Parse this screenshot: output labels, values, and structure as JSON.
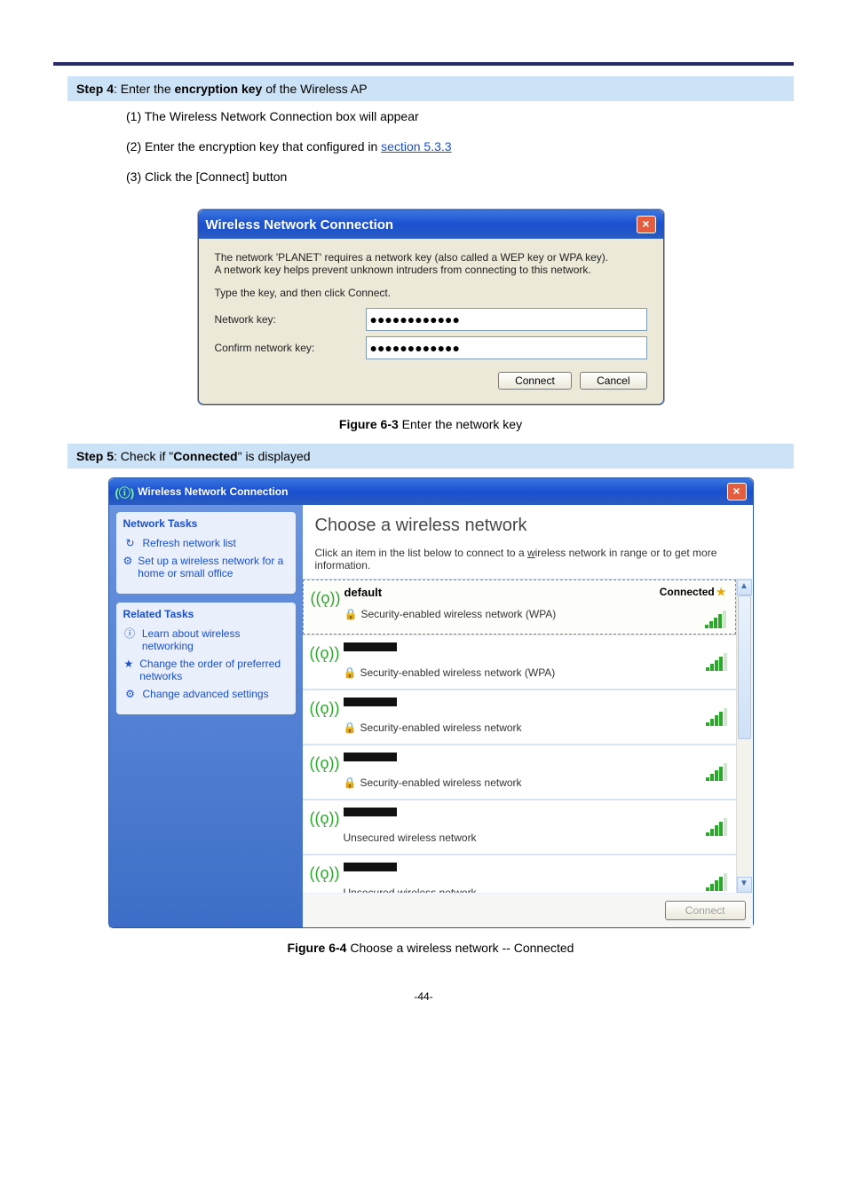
{
  "step4": {
    "label": "Step 4",
    "text1": ": Enter the ",
    "em": "encryption key",
    "text2": " of the Wireless AP",
    "items": [
      {
        "n": "(1)",
        "t": "The Wireless Network Connection box will appear"
      },
      {
        "n": "(2)",
        "t": "Enter the encryption key that configured in ",
        "link": "section 5.3.3"
      },
      {
        "n": "(3)",
        "t": "Click the [Connect] button"
      }
    ]
  },
  "dlg1": {
    "title": "Wireless Network Connection",
    "msg1": "The network 'PLANET' requires a network key (also called a WEP key or WPA key).",
    "msg2": "A network key helps prevent unknown intruders from connecting to this network.",
    "msg3": "Type the key, and then click Connect.",
    "label_key": "Network key:",
    "label_confirm": "Confirm network key:",
    "value_key": "●●●●●●●●●●●●",
    "value_confirm": "●●●●●●●●●●●●",
    "btn_connect": "Connect",
    "btn_cancel": "Cancel"
  },
  "fig1": {
    "b": "Figure 6-3",
    "t": " Enter the network key"
  },
  "step5": {
    "label": "Step 5",
    "text1": ": Check if \"",
    "em": "Connected",
    "text2": "\" is displayed"
  },
  "dlg2": {
    "title": "Wireless Network Connection",
    "sidebar": {
      "panel1_title": "Network Tasks",
      "links1": [
        {
          "icon": "↻",
          "label": "Refresh network list"
        },
        {
          "icon": "⚙",
          "label": "Set up a wireless network for a home or small office"
        }
      ],
      "panel2_title": "Related Tasks",
      "links2": [
        {
          "icon": "ⓘ",
          "label": "Learn about wireless networking"
        },
        {
          "icon": "★",
          "label": "Change the order of preferred networks"
        },
        {
          "icon": "⚙",
          "label": "Change advanced settings"
        }
      ]
    },
    "main_h1": "Choose a wireless network",
    "main_sub_a": "Click an item in the list below to connect to a ",
    "main_sub_u": "w",
    "main_sub_b": "ireless network in range or to get more information.",
    "networks": [
      {
        "ssid": "default",
        "sec": "Security-enabled wireless network (WPA)",
        "locked": true,
        "connected": true,
        "signal": 4,
        "selected": true
      },
      {
        "ssid": null,
        "sec": "Security-enabled wireless network (WPA)",
        "locked": true,
        "connected": false,
        "signal": 4
      },
      {
        "ssid": null,
        "sec": "Security-enabled wireless network",
        "locked": true,
        "connected": false,
        "signal": 4
      },
      {
        "ssid": null,
        "sec": "Security-enabled wireless network",
        "locked": true,
        "connected": false,
        "signal": 4
      },
      {
        "ssid": null,
        "sec": "Unsecured wireless network",
        "locked": false,
        "connected": false,
        "signal": 4
      },
      {
        "ssid": null,
        "sec": "Unsecured wireless network",
        "locked": false,
        "connected": false,
        "signal": 4
      }
    ],
    "connected_label": "Connected",
    "connect_btn": "Connect"
  },
  "fig2": {
    "b": "Figure 6-4",
    "t": " Choose a wireless network -- Connected"
  },
  "page_num": "-44-"
}
